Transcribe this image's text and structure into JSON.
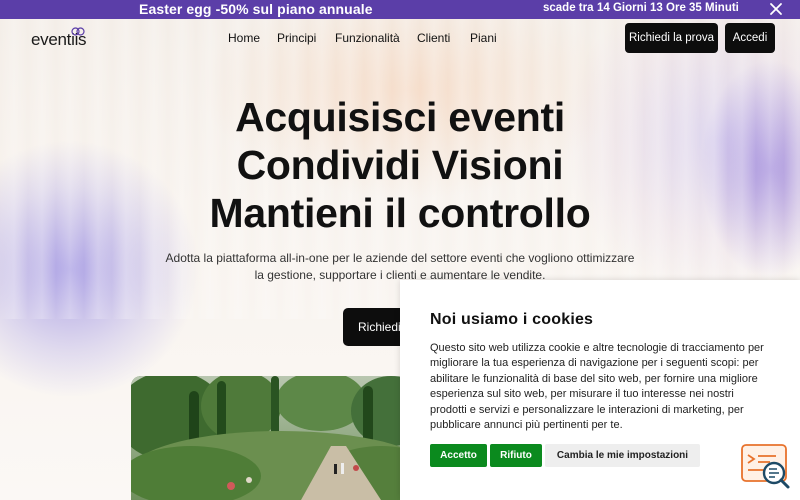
{
  "promo": {
    "message": "Easter egg -50% sul piano annuale",
    "expires_label": "scade tra",
    "countdown": "14 Giorni 13 Ore 35 Minuti"
  },
  "header": {
    "logo_text": "eventiis",
    "nav": [
      "Home",
      "Principi",
      "Funzionalità",
      "Clienti",
      "Piani"
    ],
    "demo_button": "Richiedi la prova",
    "login_button": "Accedi"
  },
  "hero": {
    "line1": "Acquisisci eventi",
    "line2": "Condividi Visioni",
    "line3": "Mantieni il controllo",
    "subtitle": "Adotta la piattaforma all-in-one per le aziende del settore eventi che vogliono ottimizzare la gestione, supportare i clienti e aumentare le vendite.",
    "cta": "Richiedi"
  },
  "cookie": {
    "title": "Noi usiamo i cookies",
    "body": "Questo sito web utilizza cookie e altre tecnologie di tracciamento per migliorare la tua esperienza di navigazione per i seguenti scopi: per abilitare le funzionalità di base del sito web, per fornire una migliore esperienza sul sito web, per misurare il tuo interesse nei nostri prodotti e servizi e personalizzare le interazioni di marketing, per pubblicare annunci più pertinenti per te.",
    "accept": "Accetto",
    "reject": "Rifiuto",
    "change": "Cambia le mie impostazioni"
  },
  "colors": {
    "promo_bg": "#5b3ea8",
    "button_dark": "#0d0d0d",
    "cookie_green": "#0b8a1e",
    "widget_orange": "#e8722c"
  },
  "icons": {
    "close": "close-icon",
    "chat": "chat-widget-icon"
  }
}
